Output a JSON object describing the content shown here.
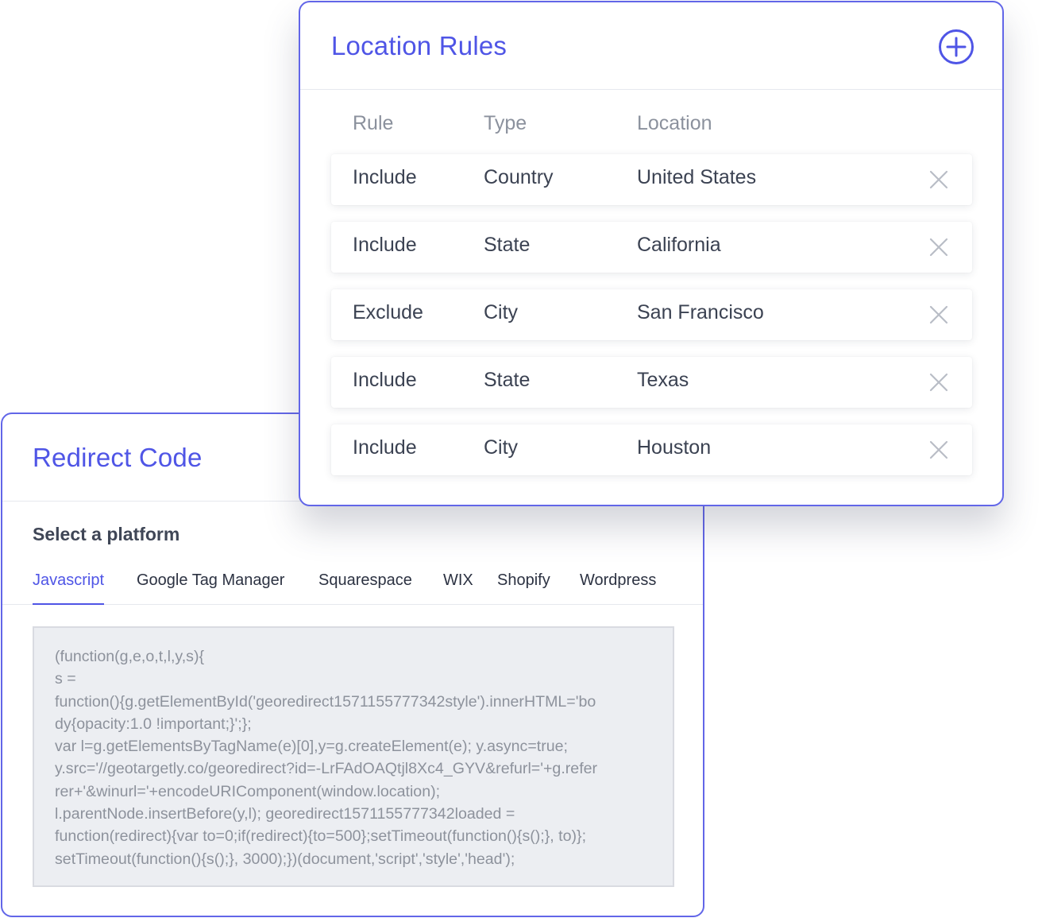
{
  "redirect": {
    "title": "Redirect Code",
    "platform_label": "Select a platform",
    "tabs": [
      {
        "label": "Javascript",
        "active": true
      },
      {
        "label": "Google Tag Manager",
        "active": false
      },
      {
        "label": "Squarespace",
        "active": false
      },
      {
        "label": "WIX",
        "active": false
      },
      {
        "label": "Shopify",
        "active": false
      },
      {
        "label": "Wordpress",
        "active": false
      }
    ],
    "code_lines": [
      "(function(g,e,o,t,l,y,s){",
      "s =",
      "function(){g.getElementById('georedirect1571155777342style').innerHTML='bo",
      "dy{opacity:1.0 !important;}';};",
      "var l=g.getElementsByTagName(e)[0],y=g.createElement(e); y.async=true;",
      "y.src='//geotargetly.co/georedirect?id=-LrFAdOAQtjl8Xc4_GYV&refurl='+g.refer",
      "rer+'&winurl='+encodeURIComponent(window.location);",
      "l.parentNode.insertBefore(y,l); georedirect1571155777342loaded =",
      "function(redirect){var to=0;if(redirect){to=500};setTimeout(function(){s();}, to)};",
      "setTimeout(function(){s();}, 3000);})(document,'script','style','head');"
    ]
  },
  "rules": {
    "title": "Location Rules",
    "add_icon": "plus-circle-icon",
    "columns": {
      "rule": "Rule",
      "type": "Type",
      "location": "Location"
    },
    "rows": [
      {
        "rule": "Include",
        "type": "Country",
        "location": "United States"
      },
      {
        "rule": "Include",
        "type": "State",
        "location": "California"
      },
      {
        "rule": "Exclude",
        "type": "City",
        "location": "San Francisco"
      },
      {
        "rule": "Include",
        "type": "State",
        "location": "Texas"
      },
      {
        "rule": "Include",
        "type": "City",
        "location": "Houston"
      }
    ],
    "remove_icon": "close-icon"
  },
  "colors": {
    "accent": "#4f55e6",
    "border": "#6266e8",
    "text": "#3b4252",
    "muted": "#8b919d",
    "code_bg": "#eceef2"
  }
}
